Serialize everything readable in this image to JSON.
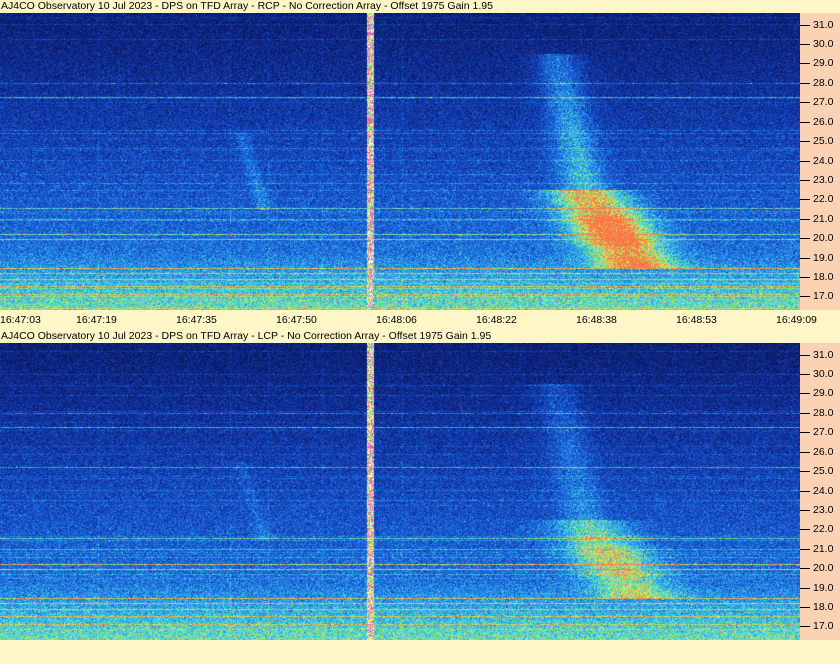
{
  "colors": {
    "background": "#fff6c8",
    "axis_panel": "#fbd3b4",
    "spectrogram_dark": "#0a1a60",
    "spectrogram_mid": "#1e5cd8",
    "spectrogram_hot": "#f5e24a"
  },
  "chart_data": [
    {
      "type": "heatmap",
      "title": "AJ4CO Observatory 10 Jul 2023 - DPS on TFD Array  - RCP  -  No Correction Array  -  Offset 1975  Gain 1.95",
      "xlabel": "",
      "ylabel": "",
      "x_ticks": [
        "16:47:03",
        "16:47:19",
        "16:47:35",
        "16:47:50",
        "16:48:06",
        "16:48:22",
        "16:48:38",
        "16:48:53",
        "16:49:09"
      ],
      "y_ticks": [
        "31.0",
        "30.0",
        "29.0",
        "28.0",
        "27.0",
        "26.0",
        "25.0",
        "24.0",
        "23.0",
        "22.0",
        "21.0",
        "20.0",
        "19.0",
        "18.0",
        "17.0"
      ],
      "ylim": [
        16.3,
        31.6
      ]
    },
    {
      "type": "heatmap",
      "title": "AJ4CO Observatory 10 Jul 2023 - DPS on TFD Array  - LCP  -  No Correction Array  -  Offset 1975  Gain 1.95",
      "xlabel": "",
      "ylabel": "",
      "x_ticks": [],
      "y_ticks": [
        "31.0",
        "30.0",
        "29.0",
        "28.0",
        "27.0",
        "26.0",
        "25.0",
        "24.0",
        "23.0",
        "22.0",
        "21.0",
        "20.0",
        "19.0",
        "18.0",
        "17.0"
      ],
      "ylim": [
        16.3,
        31.6
      ]
    }
  ]
}
